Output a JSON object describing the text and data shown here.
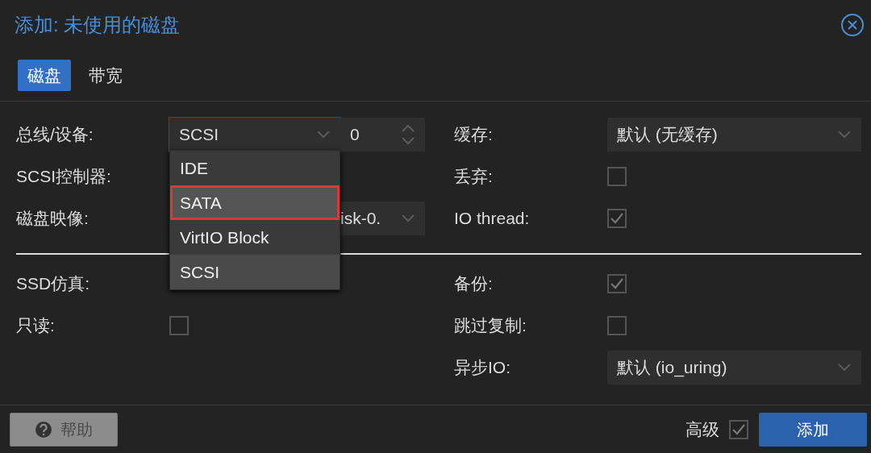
{
  "dialog": {
    "title": "添加: 未使用的磁盘"
  },
  "tabs": [
    {
      "label": "磁盘",
      "selected": true
    },
    {
      "label": "带宽",
      "selected": false
    }
  ],
  "left_top": [
    {
      "label": "总线/设备:",
      "kind": "bus",
      "value": "SCSI",
      "index": "0"
    },
    {
      "label": "SCSI控制器:",
      "kind": "covered"
    },
    {
      "label": "磁盘映像:",
      "kind": "partial_select",
      "value": "isk-0."
    }
  ],
  "right_top": [
    {
      "label": "缓存:",
      "kind": "select",
      "value": "默认 (无缓存)"
    },
    {
      "label": "丢弃:",
      "kind": "checkbox",
      "checked": false
    },
    {
      "label": "IO thread:",
      "kind": "checkbox",
      "checked": true
    }
  ],
  "left_bottom": [
    {
      "label": "SSD仿真:",
      "kind": "covered"
    },
    {
      "label": "只读:",
      "kind": "checkbox",
      "checked": false
    }
  ],
  "right_bottom": [
    {
      "label": "备份:",
      "kind": "checkbox",
      "checked": true
    },
    {
      "label": "跳过复制:",
      "kind": "checkbox",
      "checked": false
    },
    {
      "label": "异步IO:",
      "kind": "select",
      "value": "默认 (io_uring)"
    }
  ],
  "dropdown": {
    "options": [
      {
        "label": "IDE",
        "selected": false,
        "highlighted": false
      },
      {
        "label": "SATA",
        "selected": false,
        "highlighted": true
      },
      {
        "label": "VirtIO Block",
        "selected": false,
        "highlighted": false
      },
      {
        "label": "SCSI",
        "selected": true,
        "highlighted": false
      }
    ]
  },
  "footer": {
    "help_button": "帮助",
    "advanced": {
      "label": "高级",
      "checked": true
    },
    "add_button": "添加"
  }
}
